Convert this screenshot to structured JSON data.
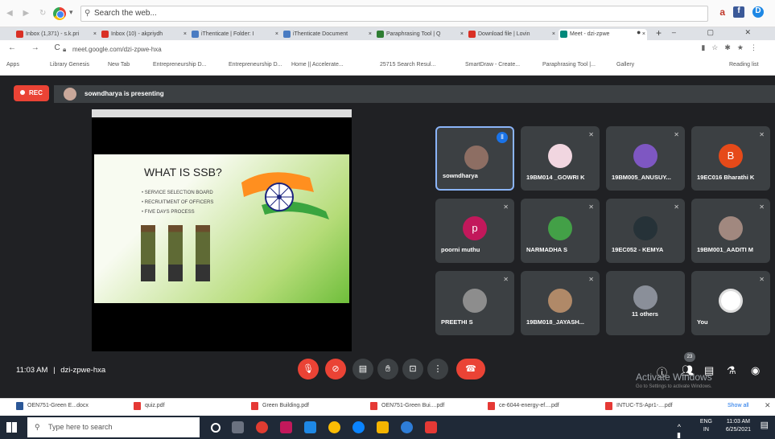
{
  "iebar": {
    "search_placeholder": "Search the web...",
    "right_icons": [
      "a",
      "fb-icon",
      "d-icon"
    ]
  },
  "tabs": [
    {
      "label": "Inbox (1,371) - s.k.pri",
      "color": "#d93025"
    },
    {
      "label": "Inbox (10) - akpriydh",
      "color": "#d93025"
    },
    {
      "label": "iThenticate | Folder: I",
      "color": "#4a7cc2"
    },
    {
      "label": "iThenticate Document",
      "color": "#4a7cc2"
    },
    {
      "label": "Paraphrasing Tool | Q",
      "color": "#2e7d32"
    },
    {
      "label": "Download file | Lovin",
      "color": "#d93025"
    },
    {
      "label": "Meet - dzi-zpwe",
      "color": "#00897b"
    }
  ],
  "address": {
    "url": "meet.google.com/dzi-zpwe-hxa"
  },
  "bookmarks": [
    "Apps",
    "Library Genesis",
    "New Tab",
    "Entrepreneurship D...",
    "Entrepreneurship D...",
    "Home || Accelerate...",
    "25715 Search Resul...",
    "SmartDraw - Create...",
    "Paraphrasing Tool |...",
    "Gallery",
    "Reading list"
  ],
  "meet": {
    "rec": "REC",
    "presenting": "sowndharya is presenting",
    "slide": {
      "title": "WHAT IS SSB?",
      "bullets": [
        "SERVICE SELECTION BOARD",
        "RECRUITMENT OF OFFICERS",
        "FIVE DAYS PROCESS"
      ]
    },
    "tiles": [
      {
        "name": "sowndharya",
        "initial": "",
        "bg": "#8d6e63"
      },
      {
        "name": "19BM014 _GOWRI K",
        "initial": "",
        "bg": "#f1d6e0"
      },
      {
        "name": "19BM005_ANUSUY...",
        "initial": "",
        "bg": "#7e57c2"
      },
      {
        "name": "19EC016 Bharathi K",
        "initial": "B",
        "bg": "#e64a19"
      },
      {
        "name": "poorni muthu",
        "initial": "p",
        "bg": "#c2185b"
      },
      {
        "name": "NARMADHA S",
        "initial": "",
        "bg": "#43a047"
      },
      {
        "name": "19EC052 - KEMYA",
        "initial": "",
        "bg": "#263238"
      },
      {
        "name": "19BM001_AADITI M",
        "initial": "",
        "bg": "#a1887f"
      },
      {
        "name": "PREETHI S",
        "initial": "",
        "bg": "#8d8d8d"
      },
      {
        "name": "19BM018_JAYASH...",
        "initial": "",
        "bg": "#b08968"
      },
      {
        "name": "11 others",
        "initial": "",
        "bg": "#8a8f99"
      },
      {
        "name": "You",
        "initial": "",
        "bg": "#ffffff"
      }
    ],
    "time": "11:03 AM",
    "separator": "|",
    "meeting_code": "dzi-zpwe-hxa",
    "people_count": "23",
    "activate_title": "Activate Windows",
    "activate_sub": "Go to Settings to activate Windows."
  },
  "downloads": [
    {
      "label": "OEN751-Green E...docx",
      "word": true
    },
    {
      "label": "quiz.pdf",
      "word": false
    },
    {
      "label": "Green Building.pdf",
      "word": false
    },
    {
      "label": "OEN751-Green Bui....pdf",
      "word": false
    },
    {
      "label": "ce-6044-energy-ef....pdf",
      "word": false
    },
    {
      "label": "INTUC-TS-Apr1-....pdf",
      "word": false
    }
  ],
  "downloads_show_all": "Show all",
  "taskbar": {
    "search": "Type here to search",
    "lang": "ENG",
    "region": "IN",
    "time": "11:03 AM",
    "date": "6/25/2021"
  }
}
